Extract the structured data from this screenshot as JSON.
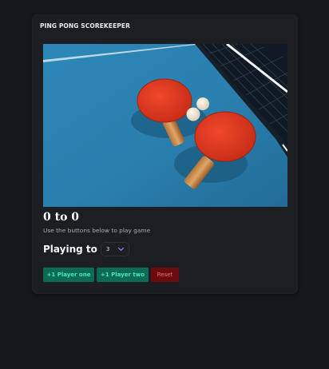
{
  "app": {
    "title": "PING PONG SCOREKEEPER"
  },
  "hero": {
    "alt": "Two red ping pong paddles and balls on a blue table"
  },
  "score": {
    "player_one": 0,
    "player_two": 0,
    "display": "0 to 0"
  },
  "hint": "Use the buttons below to play game",
  "playing_to": {
    "label": "Playing to",
    "selected": "3"
  },
  "buttons": {
    "player_one": "+1 Player one",
    "player_two": "+1 Player two",
    "reset": "Reset"
  },
  "colors": {
    "background": "#15171b",
    "card": "#1c1e22",
    "success": "#0d6b55",
    "success_text": "#4ae8b7",
    "danger": "#6b0b10",
    "danger_text": "#ee6f75",
    "table_blue": "#2980b0",
    "paddle_red": "#e23a22"
  },
  "icons": {
    "select_caret": "chevron-down-icon"
  }
}
